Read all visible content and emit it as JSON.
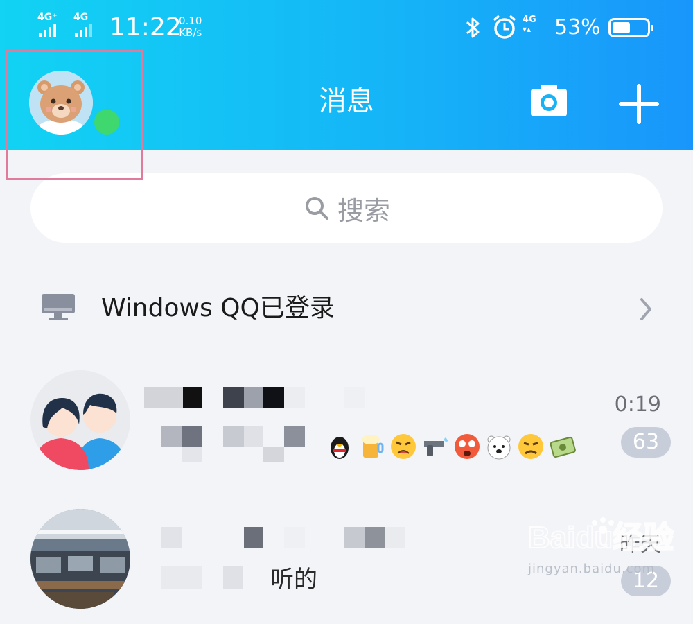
{
  "status_bar": {
    "signal1": "4G⁺",
    "signal2": "4G",
    "time": "11:22",
    "speed_value": "0.10",
    "speed_unit": "KB/s",
    "network": "4G",
    "battery_percent": "53%",
    "battery_level": 0.53
  },
  "header": {
    "title": "消息",
    "accent_start": "#12d3f4",
    "accent_end": "#1996fb",
    "online_color": "#3fd86e"
  },
  "search": {
    "placeholder": "搜索"
  },
  "pc_login": {
    "label": "Windows QQ已登录"
  },
  "chats": [
    {
      "time": "0:19",
      "unread": "63"
    },
    {
      "time": "昨天",
      "preview": "听的",
      "unread": "12"
    }
  ],
  "watermark": {
    "brand": "Baidu经验",
    "url": "jingyan.baidu.com"
  }
}
